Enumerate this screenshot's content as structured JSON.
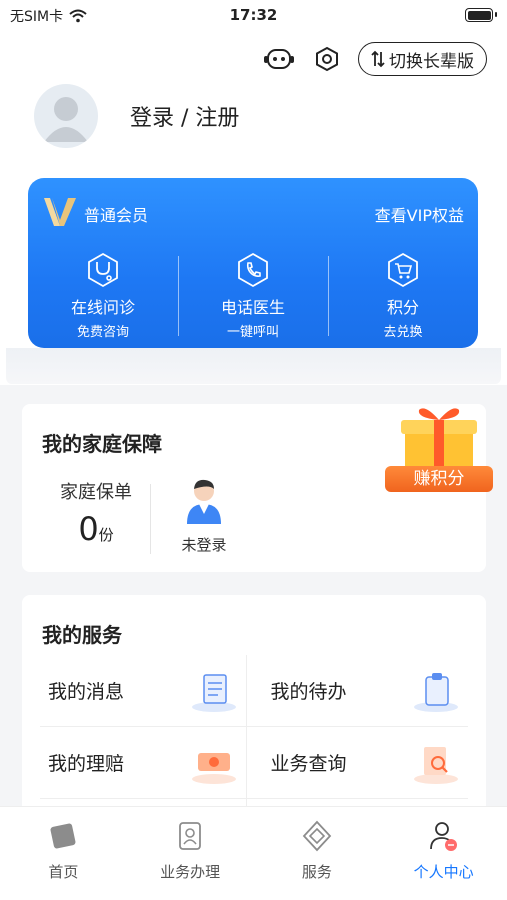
{
  "status_bar": {
    "carrier": "无SIM卡",
    "time": "17:32"
  },
  "header": {
    "elder_mode_label": "切换长辈版",
    "login_text": "登录 / 注册"
  },
  "vip_card": {
    "level": "普通会员",
    "benefits_link": "查看VIP权益",
    "items": [
      {
        "title": "在线问诊",
        "subtitle": "免费咨询",
        "icon": "stethoscope-icon"
      },
      {
        "title": "电话医生",
        "subtitle": "一键呼叫",
        "icon": "phone-icon"
      },
      {
        "title": "积分",
        "subtitle": "去兑换",
        "icon": "cart-icon"
      }
    ]
  },
  "family": {
    "title": "我的家庭保障",
    "policy_label": "家庭保单",
    "policy_count": "0",
    "policy_unit": "份",
    "member_status": "未登录",
    "earn_points": "赚积分"
  },
  "services": {
    "title": "我的服务",
    "items": [
      {
        "label": "我的消息",
        "icon": "message-doc-icon"
      },
      {
        "label": "我的待办",
        "icon": "clipboard-icon"
      },
      {
        "label": "我的理赔",
        "icon": "claim-ticket-icon"
      },
      {
        "label": "业务查询",
        "icon": "search-doc-icon"
      }
    ]
  },
  "tabbar": {
    "items": [
      {
        "label": "首页",
        "icon": "home-icon",
        "active": false
      },
      {
        "label": "业务办理",
        "icon": "business-icon",
        "active": false
      },
      {
        "label": "服务",
        "icon": "service-icon",
        "active": false
      },
      {
        "label": "个人中心",
        "icon": "profile-icon",
        "active": true
      }
    ]
  },
  "colors": {
    "primary": "#1677ff",
    "vip_card": "#1e78f4",
    "accent_orange": "#f0641e"
  }
}
